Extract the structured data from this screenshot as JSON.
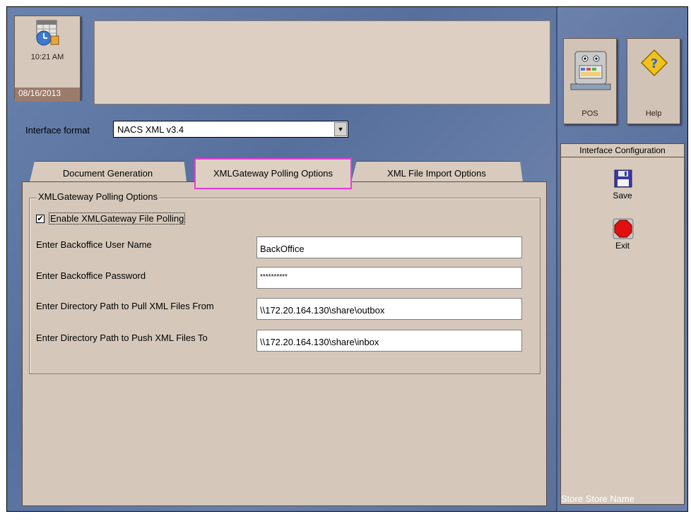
{
  "header": {
    "time": "10:21 AM",
    "date": "08/16/2013"
  },
  "interface": {
    "label": "Interface format",
    "selected": "NACS XML v3.4"
  },
  "tabs": [
    {
      "label": "Document Generation"
    },
    {
      "label": "XMLGateway Polling Options"
    },
    {
      "label": "XML File Import Options"
    }
  ],
  "polling": {
    "group_title": "XMLGateway Polling Options",
    "enable_label": "Enable XMLGateway File Polling",
    "enabled": true,
    "fields": [
      {
        "label": "Enter Backoffice User Name",
        "value": "BackOffice"
      },
      {
        "label": "Enter Backoffice Password",
        "value": "**********"
      },
      {
        "label": "Enter Directory Path to Pull XML Files From",
        "value": "\\\\172.20.164.130\\share\\outbox"
      },
      {
        "label": "Enter Directory Path to Push XML Files To",
        "value": "\\\\172.20.164.130\\share\\inbox"
      }
    ]
  },
  "sidebar": {
    "pos_label": "POS",
    "help_label": "Help",
    "title": "Interface Configuration",
    "save_label": "Save",
    "exit_label": "Exit",
    "store_name": "Store Store Name"
  },
  "icons": {
    "clock": "calendar-clock-icon",
    "pos": "pos-terminal-icon",
    "help": "help-diamond-icon",
    "save": "floppy-disk-icon",
    "exit": "stop-octagon-icon",
    "checkbox": "checkmark-icon"
  },
  "colors": {
    "active_tab_outline": "#e83bd8",
    "background": "#5f769f",
    "panel": "#d5c8bb"
  }
}
